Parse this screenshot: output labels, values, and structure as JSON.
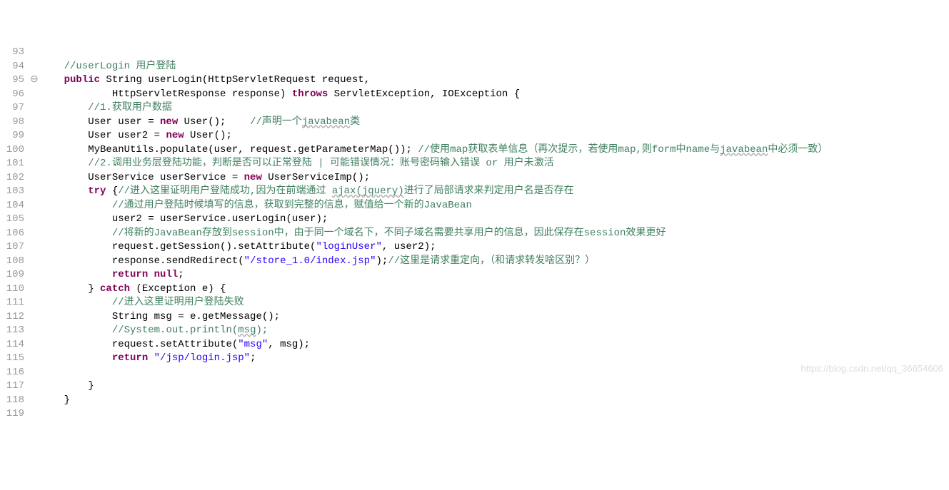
{
  "watermark": "https://blog.csdn.net/qq_36654606",
  "lines": [
    {
      "n": 93,
      "m": "",
      "tokens": []
    },
    {
      "n": 94,
      "m": "",
      "tokens": [
        {
          "t": "    ",
          "c": ""
        },
        {
          "t": "//userLogin 用户登陆",
          "c": "comment"
        }
      ]
    },
    {
      "n": 95,
      "m": "⊖",
      "tokens": [
        {
          "t": "    ",
          "c": ""
        },
        {
          "t": "public",
          "c": "kw"
        },
        {
          "t": " String userLogin(HttpServletRequest request,",
          "c": ""
        }
      ]
    },
    {
      "n": 96,
      "m": "",
      "tokens": [
        {
          "t": "            HttpServletResponse response) ",
          "c": ""
        },
        {
          "t": "throws",
          "c": "kw"
        },
        {
          "t": " ServletException, IOException {",
          "c": ""
        }
      ]
    },
    {
      "n": 97,
      "m": "",
      "tokens": [
        {
          "t": "        ",
          "c": ""
        },
        {
          "t": "//1.获取用户数据",
          "c": "comment"
        }
      ]
    },
    {
      "n": 98,
      "m": "",
      "tokens": [
        {
          "t": "        User user = ",
          "c": ""
        },
        {
          "t": "new",
          "c": "kw"
        },
        {
          "t": " User();    ",
          "c": ""
        },
        {
          "t": "//声明一个",
          "c": "comment"
        },
        {
          "t": "javabean",
          "c": "comment wavy"
        },
        {
          "t": "类",
          "c": "comment"
        }
      ]
    },
    {
      "n": 99,
      "m": "",
      "tokens": [
        {
          "t": "        User user2 = ",
          "c": ""
        },
        {
          "t": "new",
          "c": "kw"
        },
        {
          "t": " User();",
          "c": ""
        }
      ]
    },
    {
      "n": 100,
      "m": "",
      "tokens": [
        {
          "t": "        MyBeanUtils.",
          "c": ""
        },
        {
          "t": "populate",
          "c": ""
        },
        {
          "t": "(user, request.getParameterMap()); ",
          "c": ""
        },
        {
          "t": "//使用map获取表单信息（再次提示，若使用map,则form中name与",
          "c": "comment"
        },
        {
          "t": "javabean",
          "c": "comment wavy"
        },
        {
          "t": "中必须一致）",
          "c": "comment"
        }
      ]
    },
    {
      "n": 101,
      "m": "",
      "tokens": [
        {
          "t": "        ",
          "c": ""
        },
        {
          "t": "//2.调用业务层登陆功能，判断是否可以正常登陆 | 可能错误情况：账号密码输入错误 or 用户未激活",
          "c": "comment"
        }
      ]
    },
    {
      "n": 102,
      "m": "",
      "tokens": [
        {
          "t": "        UserService userService = ",
          "c": ""
        },
        {
          "t": "new",
          "c": "kw"
        },
        {
          "t": " UserServiceImp();",
          "c": ""
        }
      ]
    },
    {
      "n": 103,
      "m": "",
      "tokens": [
        {
          "t": "        ",
          "c": ""
        },
        {
          "t": "try",
          "c": "kw"
        },
        {
          "t": " {",
          "c": ""
        },
        {
          "t": "//进入这里证明用户登陆成功,因为在前端通过 ",
          "c": "comment"
        },
        {
          "t": "ajax(jquery)",
          "c": "comment wavy"
        },
        {
          "t": "进行了局部请求来判定用户名是否存在",
          "c": "comment"
        }
      ]
    },
    {
      "n": 104,
      "m": "",
      "tokens": [
        {
          "t": "            ",
          "c": ""
        },
        {
          "t": "//通过用户登陆时候填写的信息，获取到完整的信息，赋值给一个新的JavaBean",
          "c": "comment"
        }
      ]
    },
    {
      "n": 105,
      "m": "",
      "tokens": [
        {
          "t": "            user2 = userService.userLogin(user);",
          "c": ""
        }
      ]
    },
    {
      "n": 106,
      "m": "",
      "tokens": [
        {
          "t": "            ",
          "c": ""
        },
        {
          "t": "//将新的JavaBean存放到session中，由于同一个域名下，不同子域名需要共享用户的信息，因此保存在session效果更好",
          "c": "comment"
        }
      ]
    },
    {
      "n": 107,
      "m": "",
      "tokens": [
        {
          "t": "            request.getSession().setAttribute(",
          "c": ""
        },
        {
          "t": "\"loginUser\"",
          "c": "str"
        },
        {
          "t": ", user2);",
          "c": ""
        }
      ]
    },
    {
      "n": 108,
      "m": "",
      "tokens": [
        {
          "t": "            response.sendRedirect(",
          "c": ""
        },
        {
          "t": "\"/store_1.0/index.jsp\"",
          "c": "str"
        },
        {
          "t": ");",
          "c": ""
        },
        {
          "t": "//这里是请求重定向，（和请求转发啥区别？）",
          "c": "comment"
        }
      ]
    },
    {
      "n": 109,
      "m": "",
      "tokens": [
        {
          "t": "            ",
          "c": ""
        },
        {
          "t": "return",
          "c": "kw"
        },
        {
          "t": " ",
          "c": ""
        },
        {
          "t": "null",
          "c": "kw"
        },
        {
          "t": ";",
          "c": ""
        }
      ]
    },
    {
      "n": 110,
      "m": "",
      "tokens": [
        {
          "t": "        } ",
          "c": ""
        },
        {
          "t": "catch",
          "c": "kw"
        },
        {
          "t": " (Exception e) {",
          "c": ""
        }
      ]
    },
    {
      "n": 111,
      "m": "",
      "tokens": [
        {
          "t": "            ",
          "c": ""
        },
        {
          "t": "//进入这里证明用户登陆失败",
          "c": "comment"
        }
      ]
    },
    {
      "n": 112,
      "m": "",
      "tokens": [
        {
          "t": "            String msg = e.getMessage();",
          "c": ""
        }
      ]
    },
    {
      "n": 113,
      "m": "",
      "tokens": [
        {
          "t": "            ",
          "c": ""
        },
        {
          "t": "//System.out.println(",
          "c": "comment"
        },
        {
          "t": "msg",
          "c": "comment wavy"
        },
        {
          "t": ");",
          "c": "comment"
        }
      ]
    },
    {
      "n": 114,
      "m": "",
      "tokens": [
        {
          "t": "            request.setAttribute(",
          "c": ""
        },
        {
          "t": "\"msg\"",
          "c": "str"
        },
        {
          "t": ", msg);",
          "c": ""
        }
      ]
    },
    {
      "n": 115,
      "m": "",
      "tokens": [
        {
          "t": "            ",
          "c": ""
        },
        {
          "t": "return",
          "c": "kw"
        },
        {
          "t": " ",
          "c": ""
        },
        {
          "t": "\"/jsp/login.jsp\"",
          "c": "str"
        },
        {
          "t": ";",
          "c": ""
        }
      ]
    },
    {
      "n": 116,
      "m": "",
      "tokens": []
    },
    {
      "n": 117,
      "m": "",
      "tokens": [
        {
          "t": "        }",
          "c": ""
        }
      ]
    },
    {
      "n": 118,
      "m": "",
      "tokens": [
        {
          "t": "    }",
          "c": ""
        }
      ]
    },
    {
      "n": 119,
      "m": "",
      "tokens": []
    }
  ]
}
